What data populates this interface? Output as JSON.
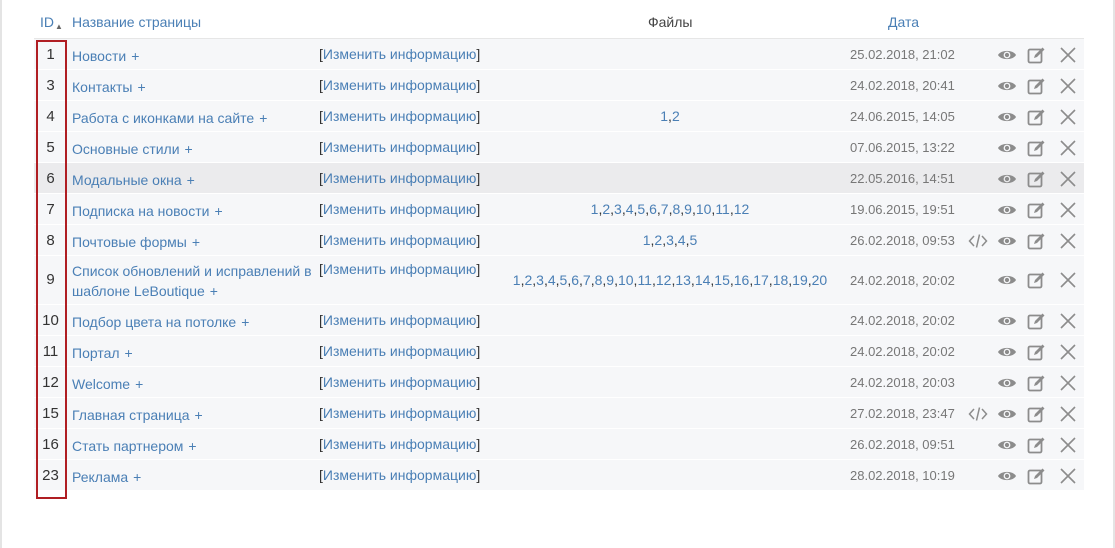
{
  "header": {
    "id": "ID",
    "sort_indicator": "▲",
    "name": "Название страницы",
    "files": "Файлы",
    "date": "Дата"
  },
  "edit_label": "Изменить информацию",
  "plus": "+",
  "rows": [
    {
      "id": "1",
      "name": "Новости",
      "files": [],
      "date": "25.02.2018, 21:02",
      "code": false,
      "highlight": false
    },
    {
      "id": "3",
      "name": "Контакты",
      "files": [],
      "date": "24.02.2018, 20:41",
      "code": false,
      "highlight": false
    },
    {
      "id": "4",
      "name": "Работа с иконками на сайте",
      "files": [
        "1",
        "2"
      ],
      "date": "24.06.2015, 14:05",
      "code": false,
      "highlight": false
    },
    {
      "id": "5",
      "name": "Основные стили",
      "files": [],
      "date": "07.06.2015, 13:22",
      "code": false,
      "highlight": false
    },
    {
      "id": "6",
      "name": "Модальные окна",
      "files": [],
      "date": "22.05.2016, 14:51",
      "code": false,
      "highlight": true
    },
    {
      "id": "7",
      "name": "Подписка на новости",
      "files": [
        "1",
        "2",
        "3",
        "4",
        "5",
        "6",
        "7",
        "8",
        "9",
        "10",
        "11",
        "12"
      ],
      "date": "19.06.2015, 19:51",
      "code": false,
      "highlight": false
    },
    {
      "id": "8",
      "name": "Почтовые формы",
      "files": [
        "1",
        "2",
        "3",
        "4",
        "5"
      ],
      "date": "26.02.2018, 09:53",
      "code": true,
      "highlight": false
    },
    {
      "id": "9",
      "name": "Список обновлений и исправлений в шаблоне LeBoutique",
      "files": [
        "1",
        "2",
        "3",
        "4",
        "5",
        "6",
        "7",
        "8",
        "9",
        "10",
        "11",
        "12",
        "13",
        "14",
        "15",
        "16",
        "17",
        "18",
        "19",
        "20"
      ],
      "date": "24.02.2018, 20:02",
      "code": false,
      "highlight": false,
      "tall": true
    },
    {
      "id": "10",
      "name": "Подбор цвета на потолке",
      "files": [],
      "date": "24.02.2018, 20:02",
      "code": false,
      "highlight": false
    },
    {
      "id": "11",
      "name": "Портал",
      "files": [],
      "date": "24.02.2018, 20:02",
      "code": false,
      "highlight": false
    },
    {
      "id": "12",
      "name": "Welcome",
      "files": [],
      "date": "24.02.2018, 20:03",
      "code": false,
      "highlight": false
    },
    {
      "id": "15",
      "name": "Главная страница",
      "files": [],
      "date": "27.02.2018, 23:47",
      "code": true,
      "highlight": false
    },
    {
      "id": "16",
      "name": "Стать партнером",
      "files": [],
      "date": "26.02.2018, 09:51",
      "code": false,
      "highlight": false
    },
    {
      "id": "23",
      "name": "Реклама",
      "files": [],
      "date": "28.02.2018, 10:19",
      "code": false,
      "highlight": false
    }
  ],
  "icons": {
    "view": "eye-icon",
    "edit": "pencil-icon",
    "delete": "close-icon",
    "code": "code-icon"
  },
  "colors": {
    "link": "#4a7fb5",
    "row_bg": "#f6f7f9",
    "row_highlight": "#ebebed",
    "annotation_border": "#b01e23"
  }
}
